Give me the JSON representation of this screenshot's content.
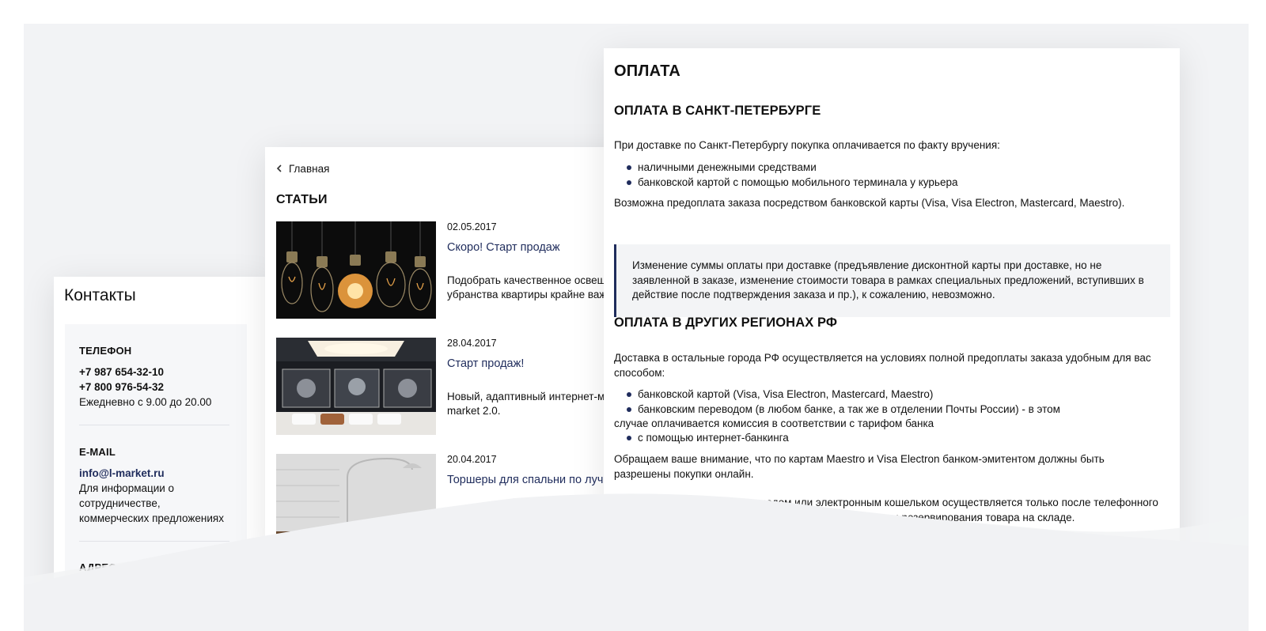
{
  "contacts": {
    "title": "Контакты",
    "phone_label": "ТЕЛЕФОН",
    "phone_1": "+7 987 654-32-10",
    "phone_2": "+7 800 976-54-32",
    "hours": "Ежедневно с 9.00 до 20.00",
    "email_label": "E-MAIL",
    "email": "info@l-market.ru",
    "email_note_1": "Для информации о",
    "email_note_2": "сотрудничестве,",
    "email_note_3": "коммерческих предложениях",
    "address_label": "АДРЕС"
  },
  "articles": {
    "breadcrumb": "Главная",
    "title": "СТАТЬИ",
    "items": [
      {
        "date": "02.05.2017",
        "title": "Скоро! Старт продаж",
        "desc_1": "Подобрать качественное освещени",
        "desc_2": "убранства квартиры крайне важно"
      },
      {
        "date": "28.04.2017",
        "title": "Старт продаж!",
        "desc_1": "Новый, адаптивный интернет-мага",
        "desc_2": "market 2.0."
      },
      {
        "date": "20.04.2017",
        "title": "Торшеры для спальни по лучшим",
        "desc_1": "",
        "desc_2": ""
      }
    ]
  },
  "payment": {
    "title": "ОПЛАТА",
    "spb_heading": "ОПЛАТА В САНКТ-ПЕТЕРБУРГЕ",
    "spb_intro": "При доставке по Санкт-Петербургу покупка оплачивается по факту вручения:",
    "spb_list": [
      "наличными денежными средствами",
      "банковской картой с помощью мобильного терминала у курьера"
    ],
    "prepay": "Возможна предоплата заказа посредством банковской карты (Visa, Visa Electron, Mastercard, Maestro).",
    "note": "Изменение суммы оплаты при доставке (предъявление дисконтной карты при доставке, но не заявленной в заказе, изменение стоимости товара в рамках специальных предложений, вступивших в действие после подтверждения заказа и пр.), к сожалению, невозможно.",
    "regions_heading": "ОПЛАТА В ДРУГИХ РЕГИОНАХ РФ",
    "regions_intro": "Доставка в остальные города РФ осуществляется на условиях полной предоплаты заказа удобным для вас способом:",
    "regions_list_1": "банковской картой (Visa, Visa Electron, Mastercard, Maestro)",
    "regions_list_2a": "банковским переводом (в любом банке, а так же в отделении Почты России) - в этом",
    "regions_list_2b": "случае оплачивается комиссия в соответствии с тарифом банка",
    "regions_list_3": "с помощью интернет-банкинга",
    "attention": "Обращаем ваше внимание, что по картам Maestro и Visa Electron банком-эмитентом должны быть разрешены покупки онлайн.",
    "transfer": "Предоплата банковским переводом или электронным кошельком осуществляется только после телефонного подтверждения заказа менеджером интернет-магазина и резервирования товара на складе."
  }
}
